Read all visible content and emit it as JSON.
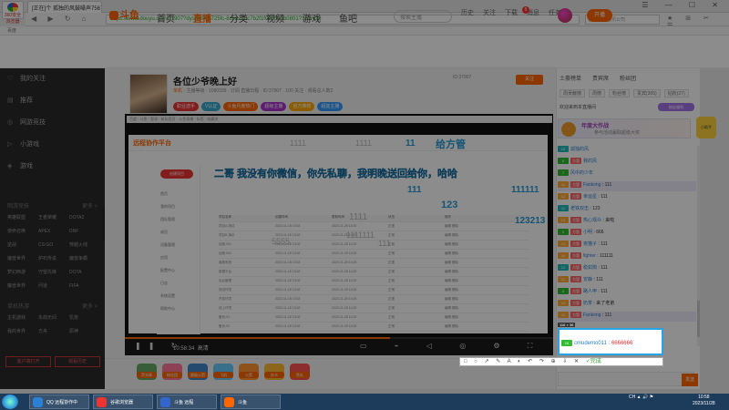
{
  "browser": {
    "logo_label": "360安全浏览器",
    "tab_title": "[正在]个 孤独的风鼓噪声7567-",
    "window_controls": "☰ — ☐ ✕",
    "url": "https://www.douyu.com/37907?dyshid=0c725fc-8c5a2d0c7b2f1f0805e1b0801?3c/h=29",
    "search_placeholder": "国营电子通讯公司",
    "bookmarks_label": "百度"
  },
  "site": {
    "logo_text": "斗鱼",
    "nav": [
      "首页",
      "直播",
      "分类",
      "视频",
      "游戏",
      "鱼吧"
    ],
    "nav_active_index": 1,
    "search_placeholder": "搜索主播",
    "header_icons": [
      "历史",
      "关注",
      "下载",
      "消息",
      "任务"
    ],
    "message_count": "5",
    "open_live_label": "开播"
  },
  "sidebar": {
    "items": [
      {
        "icon": "heart-icon",
        "label": "我的关注"
      },
      {
        "icon": "grid-icon",
        "label": "推荐"
      },
      {
        "icon": "globe-icon",
        "label": "网游竞技"
      },
      {
        "icon": "play-icon",
        "label": "小游戏"
      },
      {
        "icon": "controller-icon",
        "label": "游戏"
      }
    ],
    "section1": "网游竞技",
    "section1_more": "更多 >",
    "games": [
      "英雄联盟",
      "王者荣耀",
      "DOTA2",
      "使命召唤",
      "APEX",
      "DNF",
      "逆战",
      "CS:GO",
      "穿越火线",
      "魔兽世界",
      "炉石传说",
      "魔兽争霸",
      "梦幻西游",
      "守望先锋",
      "DOTA",
      "魔兽世界",
      "问道",
      "FIFA"
    ],
    "section2": "单机热游",
    "section2_more": "更多 >",
    "games2": [
      "主机游戏",
      "永劫无间",
      "饥荒",
      "我的世界",
      "方舟",
      "原神"
    ],
    "btn_client": "客户端打开",
    "btn_record": "观看历史"
  },
  "room": {
    "title": "各位少爷晚上好",
    "category": "单机",
    "meta": "主播等级 · 1090339 · 订阅 直播日程",
    "stats": "ID:37907 · 100 关注 · 观看总人数2",
    "tags": [
      "职业选手",
      "V认证",
      "斗鱼月度热门",
      "超级主播",
      "官方推荐",
      "超能主播"
    ],
    "right_info": "ID:37907",
    "follow_label": "关注"
  },
  "player": {
    "inner_bar": "百度 · 斗鱼 · 登录 · 新标签页 · 斗鱼直播 · 标签 · 收藏夹",
    "shared_logo": "远程协作平台",
    "banner": "二哥 我没有你微信，你先私聊，我明晚送回给你，哈哈",
    "gift_title": "给方管",
    "danmaku": [
      {
        "text": "1111",
        "cls": "gray"
      },
      {
        "text": "11",
        "cls": ""
      },
      {
        "text": "1111",
        "cls": "gray"
      },
      {
        "text": "111",
        "cls": ""
      },
      {
        "text": "123",
        "cls": ""
      },
      {
        "text": "111111",
        "cls": ""
      },
      {
        "text": "123213",
        "cls": ""
      },
      {
        "text": "1111",
        "cls": "gray"
      },
      {
        "text": "1111111",
        "cls": "gray"
      },
      {
        "text": "111",
        "cls": "gray"
      },
      {
        "text": "5555",
        "cls": "gray"
      }
    ],
    "shared_side_btn": "创建项目",
    "shared_side_rows": [
      "首页",
      "我的项目",
      "团队管理",
      "成员",
      "设备管理",
      "应用",
      "配置中心",
      "日志",
      "系统设置",
      "帮助中心"
    ],
    "table_header": [
      "项目名称",
      "创建时间",
      "更新时间",
      "状态",
      "操作"
    ],
    "table_rows": [
      [
        "项目A-测试",
        "2023-11-18 13:02",
        "2023-11-28 14:20",
        "正常",
        "编辑 删除"
      ],
      [
        "项目B-演示",
        "2023-11-18 13:02",
        "2023-11-28 14:20",
        "正常",
        "编辑 删除"
      ],
      [
        "远程-001",
        "2023-11-18 13:02",
        "2023-11-28 14:20",
        "正常",
        "编辑 删除"
      ],
      [
        "远程-002",
        "2023-11-18 13:02",
        "2023-11-28 14:20",
        "正常",
        "编辑 删除"
      ],
      [
        "客服系统",
        "2023-11-18 13:02",
        "2023-11-28 14:20",
        "正常",
        "编辑 删除"
      ],
      [
        "数据平台",
        "2023-11-18 13:02",
        "2023-11-28 14:20",
        "正常",
        "编辑 删除"
      ],
      [
        "后台管理",
        "2023-11-18 13:02",
        "2023-11-28 14:20",
        "正常",
        "编辑 删除"
      ],
      [
        "测试环境",
        "2023-11-18 13:02",
        "2023-11-28 14:20",
        "正常",
        "编辑 删除"
      ],
      [
        "开发环境",
        "2023-11-18 13:02",
        "2023-11-28 14:20",
        "正常",
        "编辑 删除"
      ],
      [
        "线上环境",
        "2023-11-18 13:02",
        "2023-11-28 14:20",
        "正常",
        "编辑 删除"
      ],
      [
        "备份-01",
        "2023-11-18 13:02",
        "2023-11-28 14:20",
        "正常",
        "编辑 删除"
      ],
      [
        "备份-02",
        "2023-11-18 13:02",
        "2023-11-28 14:20",
        "正常",
        "编辑 删除"
      ]
    ],
    "time": "10:58:34",
    "quality": "高清",
    "progress": 0.62
  },
  "gifts": [
    {
      "label": "荧光棒",
      "color": "#6a6"
    },
    {
      "label": "粉丝团",
      "color": "#f79"
    },
    {
      "label": "超级火箭",
      "color": "#48c"
    },
    {
      "label": "飞机",
      "color": "#6cf"
    },
    {
      "label": "火箭",
      "color": "#f93"
    },
    {
      "label": "办卡",
      "color": "#fb3"
    },
    {
      "label": "鱼丸",
      "color": "#f55"
    }
  ],
  "chat": {
    "tabs": [
      "土豪榜单",
      "贵宾席",
      "粉丝团"
    ],
    "rank_tabs": [
      "周贡献榜",
      "周榜",
      "粉丝榜",
      "贵宾(305)",
      "钻粉(27)"
    ],
    "notice": "欢迎来到本直播间",
    "purple_btn": "粉丝福利",
    "event_title": "年度大作战",
    "event_sub": "参与活动赢取超级大奖",
    "robot_label": "小助手",
    "messages": [
      {
        "lv": "15",
        "lv_color": "#2bb",
        "fan": "",
        "nick": "孤独的风",
        "text": "",
        "alt": false
      },
      {
        "lv": "8",
        "lv_color": "#3b3",
        "fan": "方管",
        "nick": "我的风",
        "text": "",
        "alt": false
      },
      {
        "lv": "7",
        "lv_color": "#3b3",
        "fan": "",
        "nick": "风中的少年",
        "text": "",
        "alt": false
      },
      {
        "lv": "16",
        "lv_color": "#fa3",
        "fan": "方管",
        "nick": "Fankong",
        "text": "111",
        "alt": true
      },
      {
        "lv": "12",
        "lv_color": "#fa3",
        "fan": "方管",
        "nick": "幸运星",
        "text": "111",
        "alt": false
      },
      {
        "lv": "11",
        "lv_color": "#2bb",
        "fan": "",
        "nick": "老铁双击",
        "text": "123",
        "alt": false
      },
      {
        "lv": "13",
        "lv_color": "#fa3",
        "fan": "方管",
        "nick": "热心观众",
        "text": "来啦",
        "alt": false
      },
      {
        "lv": "9",
        "lv_color": "#3b3",
        "fan": "方管",
        "nick": "小明",
        "text": "666",
        "alt": false
      },
      {
        "lv": "10",
        "lv_color": "#fa3",
        "fan": "方管",
        "nick": "夜猫子",
        "text": "111",
        "alt": false
      },
      {
        "lv": "14",
        "lv_color": "#fa3",
        "fan": "方管",
        "nick": "fighter",
        "text": "111111",
        "alt": false
      },
      {
        "lv": "12",
        "lv_color": "#2bb",
        "fan": "方管",
        "nick": "稳如狗",
        "text": "111",
        "alt": false
      },
      {
        "lv": "11",
        "lv_color": "#fa3",
        "fan": "方管",
        "nick": "安静",
        "text": "111",
        "alt": false
      },
      {
        "lv": "8",
        "lv_color": "#3b3",
        "fan": "方管",
        "nick": "路人甲",
        "text": "111",
        "alt": false
      },
      {
        "lv": "10",
        "lv_color": "#fa3",
        "fan": "方管",
        "nick": "奶茶",
        "text": "来了老弟",
        "alt": false
      },
      {
        "lv": "16",
        "lv_color": "#fa3",
        "fan": "方管",
        "nick": "Fankong",
        "text": "111",
        "alt": true
      }
    ],
    "screenshot_size": "116 × 36",
    "screenshot_nick": "cmudemo011",
    "screenshot_text": "6666666",
    "screenshot_lv": "10",
    "screenshot_tools": "□ ○ ↗ ✎ A ◐ ↶ ↷ ⊕ ⇩ ✕",
    "screenshot_done": "✓完成",
    "send_label": "发送"
  },
  "taskbar": {
    "apps": [
      {
        "label": "QQ 远程协作中",
        "color": "#2b7fd4"
      },
      {
        "label": "谷歌浏览器",
        "color": "#e33"
      },
      {
        "label": "斗鱼 远程",
        "color": "#36c"
      },
      {
        "label": "斗鱼",
        "color": "#f60"
      }
    ],
    "tray": "CH ▲ 🔊 ⚑",
    "clock_time": "10:58",
    "clock_date": "2023/11/28"
  }
}
